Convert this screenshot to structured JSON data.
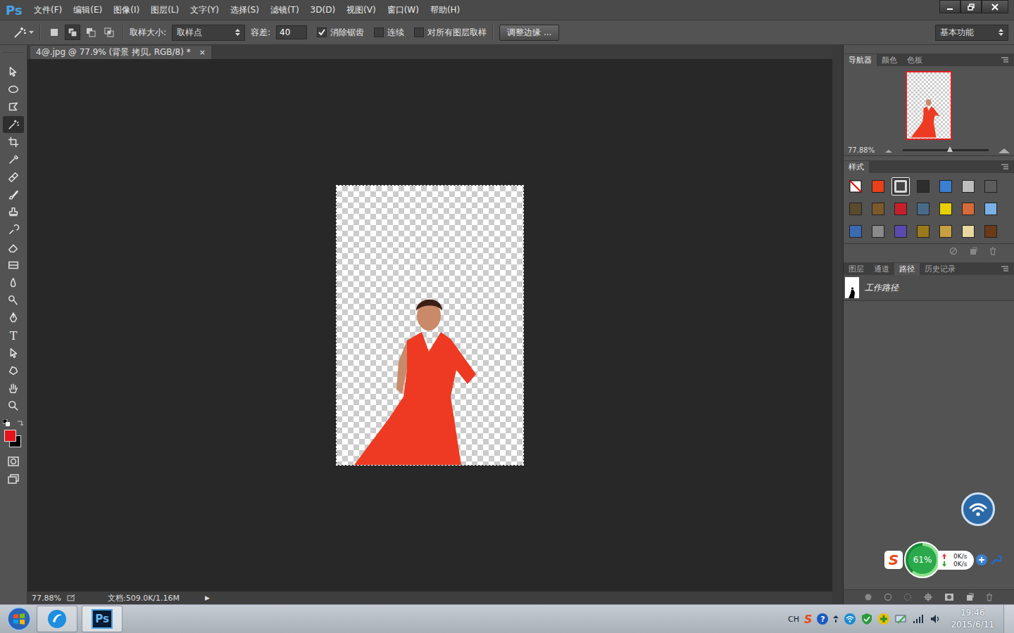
{
  "app": {
    "logo": "Ps"
  },
  "menu": [
    "文件(F)",
    "编辑(E)",
    "图像(I)",
    "图层(L)",
    "文字(Y)",
    "选择(S)",
    "滤镜(T)",
    "3D(D)",
    "视图(V)",
    "窗口(W)",
    "帮助(H)"
  ],
  "options_bar": {
    "selection_modes": [
      {
        "kind": "new",
        "selected": false
      },
      {
        "kind": "add",
        "selected": true
      },
      {
        "kind": "subtract",
        "selected": false
      },
      {
        "kind": "intersect",
        "selected": false
      }
    ],
    "sample_size": {
      "label": "取样大小:",
      "value": "取样点"
    },
    "tolerance": {
      "label": "容差:",
      "value": "40"
    },
    "checkboxes": [
      {
        "label": "消除锯齿",
        "checked": true
      },
      {
        "label": "连续",
        "checked": false
      },
      {
        "label": "对所有图层取样",
        "checked": false
      }
    ],
    "refine_button": "调整边缘 ...",
    "workspace": "基本功能"
  },
  "document": {
    "tab": "4@.jpg @ 77.9% (背景 拷贝, RGB/8) *",
    "close": "×"
  },
  "tools": [
    {
      "kind": "move",
      "selected": false
    },
    {
      "kind": "ellipse",
      "selected": false
    },
    {
      "kind": "lasso",
      "selected": false
    },
    {
      "kind": "wand",
      "selected": true
    },
    {
      "kind": "crop",
      "selected": false
    },
    {
      "kind": "eyedropper",
      "selected": false
    },
    {
      "kind": "healing",
      "selected": false
    },
    {
      "kind": "brush",
      "selected": false
    },
    {
      "kind": "stamp",
      "selected": false
    },
    {
      "kind": "history",
      "selected": false
    },
    {
      "kind": "eraser",
      "selected": false
    },
    {
      "kind": "gradient",
      "selected": false
    },
    {
      "kind": "blur",
      "selected": false
    },
    {
      "kind": "dodge",
      "selected": false
    },
    {
      "kind": "pen",
      "selected": false
    },
    {
      "kind": "text",
      "label": "T",
      "selected": false
    },
    {
      "kind": "pathselect",
      "selected": false
    },
    {
      "kind": "shape",
      "selected": false
    },
    {
      "kind": "hand",
      "selected": false
    },
    {
      "kind": "zoom",
      "selected": false
    }
  ],
  "color_swatches": [
    {
      "kind": "foreground",
      "color": "#e8141b"
    },
    {
      "kind": "background",
      "color": "#000000"
    }
  ],
  "status_bar": {
    "zoom": "77.88%",
    "doc": "文档:509.0K/1.16M",
    "arrow": "▶"
  },
  "navigator": {
    "tabs": [
      {
        "label": "导航器",
        "selected": true
      },
      {
        "label": "颜色",
        "selected": false
      },
      {
        "label": "色板",
        "selected": false
      }
    ],
    "zoom": "77.88%",
    "level": 0.55
  },
  "styles": {
    "title": "样式",
    "swatches": [
      {
        "kind": "none",
        "color": "#ffffff",
        "selected": false
      },
      {
        "kind": "fill",
        "color": "#e8401a",
        "selected": false
      },
      {
        "kind": "frame",
        "color": "#d8d8d8",
        "selected": true
      },
      {
        "kind": "fill",
        "color": "#2e2e2e",
        "selected": false
      },
      {
        "kind": "fill",
        "color": "#3a7fd0",
        "selected": false
      },
      {
        "kind": "fill",
        "color": "#bdbdbd",
        "selected": false
      },
      {
        "kind": "fill",
        "color": "#5c5c5c",
        "selected": false
      },
      {
        "kind": "fill",
        "color": "#5a4a2e",
        "selected": false
      },
      {
        "kind": "fill",
        "color": "#7a5a2a",
        "selected": false
      },
      {
        "kind": "fill",
        "color": "#c8202a",
        "selected": false
      },
      {
        "kind": "fill",
        "color": "#4a6a8a",
        "selected": false
      },
      {
        "kind": "fill",
        "color": "#e8d000",
        "selected": false
      },
      {
        "kind": "fill",
        "color": "#d86a3a",
        "selected": false
      },
      {
        "kind": "fill",
        "color": "#7ab0e8",
        "selected": false
      },
      {
        "kind": "fill",
        "color": "#3a6ab0",
        "selected": false
      },
      {
        "kind": "fill",
        "color": "#8a8a8a",
        "selected": false
      },
      {
        "kind": "fill",
        "color": "#5a4ab0",
        "selected": false
      },
      {
        "kind": "fill",
        "color": "#9a7a1a",
        "selected": false
      },
      {
        "kind": "fill",
        "color": "#c8a040",
        "selected": false
      },
      {
        "kind": "fill",
        "color": "#e8d8a0",
        "selected": false
      },
      {
        "kind": "fill",
        "color": "#6a3a1a",
        "selected": false
      }
    ]
  },
  "layers_panel": {
    "tabs": [
      {
        "label": "图层",
        "selected": false
      },
      {
        "label": "通道",
        "selected": false
      },
      {
        "label": "路径",
        "selected": true
      },
      {
        "label": "历史记录",
        "selected": false
      }
    ],
    "paths": [
      {
        "name": "工作路径",
        "selected": false
      }
    ]
  },
  "net_widget": {
    "logo": "S",
    "percent": "61%",
    "level": 0.61,
    "up": "0K/s",
    "down": "0K/s"
  },
  "taskbar": {
    "apps": [
      {
        "kind": "browser",
        "selected": false
      },
      {
        "kind": "photoshop",
        "label": "Ps",
        "selected": true
      }
    ],
    "lang": "CH",
    "sogou": "S",
    "help": "?",
    "time": "19:46",
    "date": "2015/6/11"
  }
}
